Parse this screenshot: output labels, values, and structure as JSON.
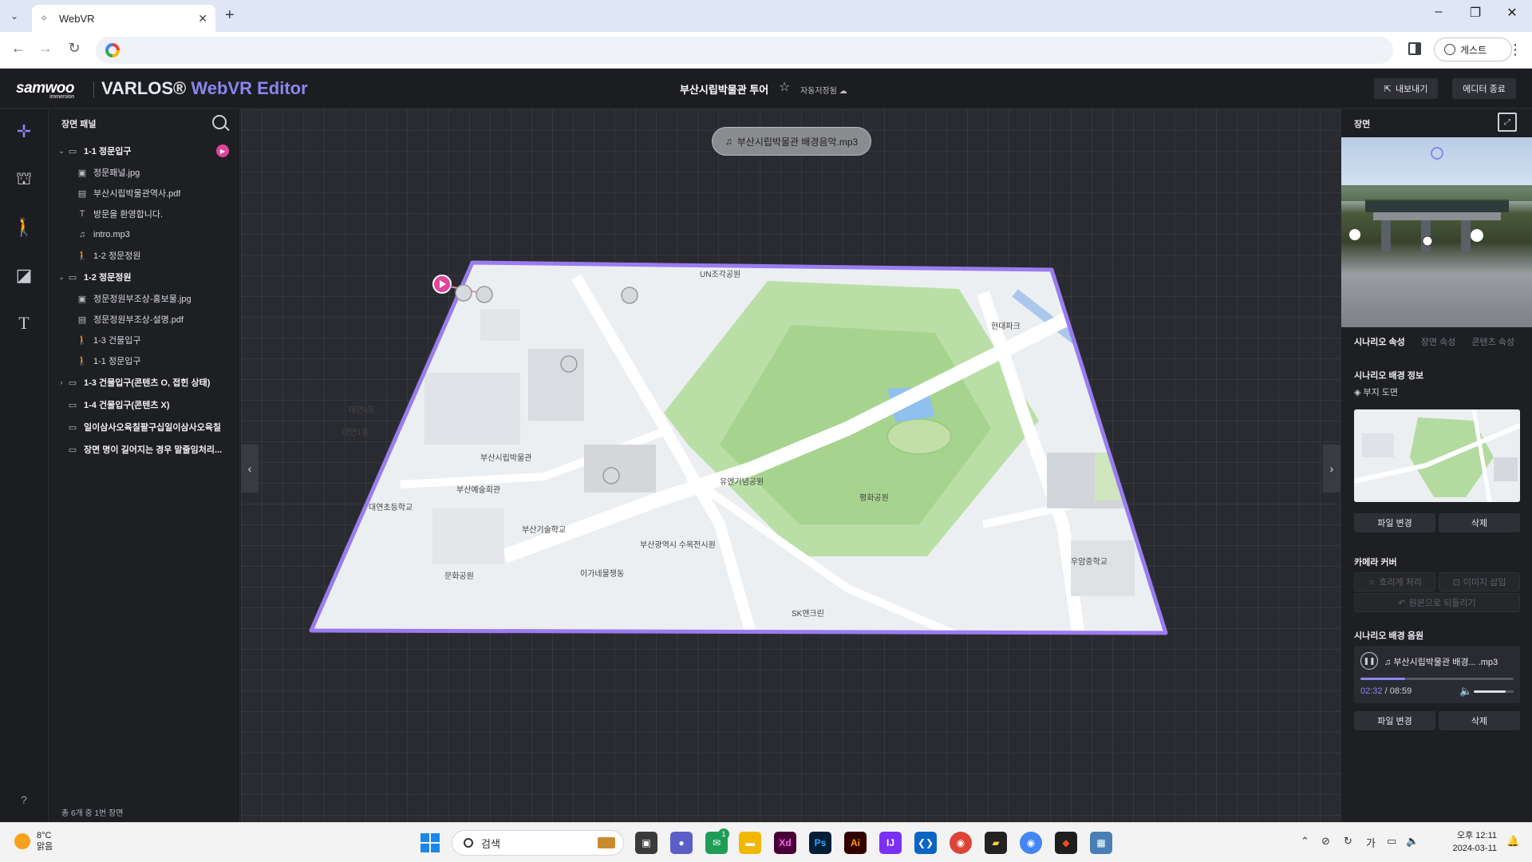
{
  "browser": {
    "tab_title": "WebVR",
    "tab_dropdown": "⌄",
    "tab_close": "✕",
    "new_tab": "+",
    "profile_label": "게스트",
    "window_controls": [
      "–",
      "❐",
      "✕"
    ]
  },
  "header": {
    "logo": "samwoo",
    "logo_sub": "immersion",
    "brand": "VARLOS®",
    "brand_sub": "WebVR Editor",
    "doc_title": "부산시립박물관 투어",
    "autosave": "자동저장됨",
    "export_label": "내보내기",
    "exit_label": "에디터 종료"
  },
  "tools": [
    {
      "name": "move-tool",
      "glyph": "✛",
      "active": true
    },
    {
      "name": "scene-tool",
      "glyph": "⛫",
      "active": false
    },
    {
      "name": "walk-tool",
      "glyph": "🚶",
      "active": false
    },
    {
      "name": "note-tool",
      "glyph": "◪",
      "active": false
    },
    {
      "name": "text-tool",
      "glyph": "T",
      "active": false
    }
  ],
  "help_label": "?",
  "scene_panel": {
    "title": "장면 패널",
    "footer": "총 6개 중 1번 장면",
    "rows": [
      {
        "type": "scene",
        "label": "1-1 정문입구",
        "chev": "⌄",
        "icon": "▭",
        "play": true
      },
      {
        "type": "item",
        "label": "정문패널.jpg",
        "icon": "▣"
      },
      {
        "type": "item",
        "label": "부산시립박물관역사.pdf",
        "icon": "▤"
      },
      {
        "type": "item",
        "label": "방문을 환영합니다.",
        "icon": "T"
      },
      {
        "type": "item",
        "label": "intro.mp3",
        "icon": "♫"
      },
      {
        "type": "item",
        "label": "1-2 정문정원",
        "icon": "🚶"
      },
      {
        "type": "scene",
        "label": "1-2 정문정원",
        "chev": "⌄",
        "icon": "▭"
      },
      {
        "type": "item",
        "label": "정문정원부조상-홍보물.jpg",
        "icon": "▣"
      },
      {
        "type": "item",
        "label": "정문정원부조상-설명.pdf",
        "icon": "▤"
      },
      {
        "type": "item",
        "label": "1-3 건물입구",
        "icon": "🚶"
      },
      {
        "type": "item",
        "label": "1-1 정문입구",
        "icon": "🚶"
      },
      {
        "type": "scene",
        "label": "1-3 건물입구(콘텐츠 O, 접힌 상태)",
        "chev": "›",
        "icon": "▭"
      },
      {
        "type": "scene",
        "label": "1-4 건물입구(콘텐츠 X)",
        "chev": "",
        "icon": "▭"
      },
      {
        "type": "scene",
        "label": "일이삼사오육칠팔구십일이삼사오육칠",
        "chev": "",
        "icon": "▭"
      },
      {
        "type": "scene",
        "label": "장면 명이 길어지는 경우 말줄임처리...",
        "chev": "",
        "icon": "▭"
      }
    ]
  },
  "viewport": {
    "audio_file": "부산시립박물관 배경음악.mp3",
    "audio_icon": "♫",
    "left_arrow": "‹",
    "right_arrow": "›",
    "map_labels": [
      "대연4동",
      "대연1동",
      "부산시립박물관",
      "유엔기념공원",
      "UN조각공원",
      "평화공원",
      "부산광역시 수목전시원",
      "이가네물쟁동",
      "문화공원",
      "SK엔크린",
      "부산예술회관",
      "대연초등학교",
      "우암중학교",
      "부산기술학교",
      "현대파크"
    ]
  },
  "right_panel": {
    "title": "장면",
    "tabs": [
      "시나리오 속성",
      "장면 속성",
      "콘텐츠 속성"
    ],
    "section_bg": "시나리오 배경 정보",
    "bg_type": "부지 도면",
    "change_file": "파일 변경",
    "delete": "삭제",
    "section_camera": "카메라 커버",
    "blur": "흐리게 처리",
    "insert_image": "이미지 삽입",
    "restore": "원본으로 되돌리기",
    "section_audio": "시나리오 배경 음원",
    "audio_title": "부산시립박물관 배경... .mp3",
    "current_time": "02:32",
    "total_time": "08:59",
    "time_sep": " / ",
    "progress": 0.29,
    "volume": 0.8
  },
  "taskbar": {
    "temp": "8°C",
    "weather": "맑음",
    "search_placeholder": "검색",
    "time": "오후 12:11",
    "date": "2024-03-11",
    "ime": "가",
    "badge": "1"
  },
  "colors": {
    "accent": "#8a86f0",
    "play_pink": "#e0449c",
    "map_border": "#9b7cf0"
  }
}
